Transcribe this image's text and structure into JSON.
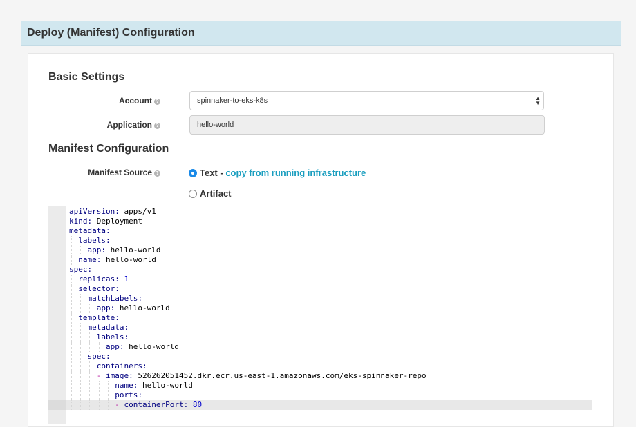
{
  "header": {
    "title": "Deploy (Manifest) Configuration"
  },
  "basic_settings": {
    "title": "Basic Settings",
    "account": {
      "label": "Account",
      "help_icon": "question-circle-icon",
      "value": "spinnaker-to-eks-k8s"
    },
    "application": {
      "label": "Application",
      "help_icon": "question-circle-icon",
      "value": "hello-world"
    }
  },
  "manifest_configuration": {
    "title": "Manifest Configuration",
    "source": {
      "label": "Manifest Source",
      "options": [
        {
          "label": "Text",
          "selected": true,
          "separator": " - ",
          "link": "copy from running infrastructure"
        },
        {
          "label": "Artifact",
          "selected": false
        }
      ]
    }
  },
  "editor": {
    "lines": [
      {
        "indent": 0,
        "dash": false,
        "key": "apiVersion:",
        "value": " apps/v1",
        "value_type": "str"
      },
      {
        "indent": 0,
        "dash": false,
        "key": "kind:",
        "value": " Deployment",
        "value_type": "str"
      },
      {
        "indent": 0,
        "dash": false,
        "key": "metadata:",
        "value": "",
        "value_type": "str"
      },
      {
        "indent": 1,
        "dash": false,
        "key": "labels:",
        "value": "",
        "value_type": "str"
      },
      {
        "indent": 2,
        "dash": false,
        "key": "app:",
        "value": " hello-world",
        "value_type": "str"
      },
      {
        "indent": 1,
        "dash": false,
        "key": "name:",
        "value": " hello-world",
        "value_type": "str"
      },
      {
        "indent": 0,
        "dash": false,
        "key": "spec:",
        "value": "",
        "value_type": "str"
      },
      {
        "indent": 1,
        "dash": false,
        "key": "replicas:",
        "value": " 1",
        "value_type": "num"
      },
      {
        "indent": 1,
        "dash": false,
        "key": "selector:",
        "value": "",
        "value_type": "str"
      },
      {
        "indent": 2,
        "dash": false,
        "key": "matchLabels:",
        "value": "",
        "value_type": "str"
      },
      {
        "indent": 3,
        "dash": false,
        "key": "app:",
        "value": " hello-world",
        "value_type": "str"
      },
      {
        "indent": 1,
        "dash": false,
        "key": "template:",
        "value": "",
        "value_type": "str"
      },
      {
        "indent": 2,
        "dash": false,
        "key": "metadata:",
        "value": "",
        "value_type": "str"
      },
      {
        "indent": 3,
        "dash": false,
        "key": "labels:",
        "value": "",
        "value_type": "str"
      },
      {
        "indent": 4,
        "dash": false,
        "key": "app:",
        "value": " hello-world",
        "value_type": "str"
      },
      {
        "indent": 2,
        "dash": false,
        "key": "spec:",
        "value": "",
        "value_type": "str"
      },
      {
        "indent": 3,
        "dash": false,
        "key": "containers:",
        "value": "",
        "value_type": "str"
      },
      {
        "indent": 4,
        "dash": true,
        "key": "image:",
        "value": " 526262051452.dkr.ecr.us-east-1.amazonaws.com/eks-spinnaker-repo",
        "value_type": "str"
      },
      {
        "indent": 5,
        "dash": false,
        "key": "name:",
        "value": " hello-world",
        "value_type": "str"
      },
      {
        "indent": 5,
        "dash": false,
        "key": "ports:",
        "value": "",
        "value_type": "str"
      },
      {
        "indent": 6,
        "dash": true,
        "key": "containerPort:",
        "value": " 80",
        "value_type": "num"
      }
    ]
  }
}
